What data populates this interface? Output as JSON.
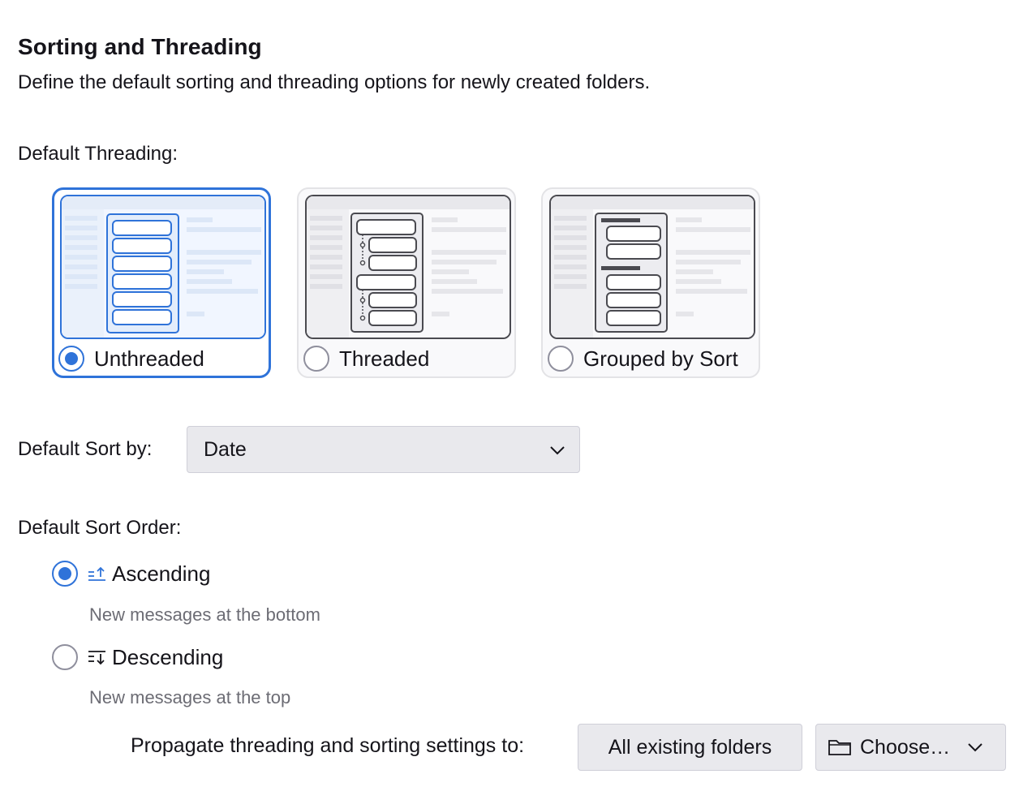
{
  "section": {
    "title": "Sorting and Threading",
    "description": "Define the default sorting and threading options for newly created folders."
  },
  "threading": {
    "label": "Default Threading:",
    "options": [
      {
        "label": "Unthreaded",
        "selected": true
      },
      {
        "label": "Threaded",
        "selected": false
      },
      {
        "label": "Grouped by Sort",
        "selected": false
      }
    ]
  },
  "sort_by": {
    "label": "Default Sort by:",
    "value": "Date"
  },
  "sort_order": {
    "label": "Default Sort Order:",
    "options": [
      {
        "label": "Ascending",
        "hint": "New messages at the bottom",
        "selected": true,
        "icon": "sort-ascending-icon"
      },
      {
        "label": "Descending",
        "hint": "New messages at the top",
        "selected": false,
        "icon": "sort-descending-icon"
      }
    ]
  },
  "propagate": {
    "label": "Propagate threading and sorting settings to:",
    "all_button": "All existing folders",
    "choose_button": "Choose…"
  },
  "colors": {
    "accent": "#2f73d9",
    "button_bg": "#e9e9ed",
    "hint_text": "#6c6c74"
  }
}
